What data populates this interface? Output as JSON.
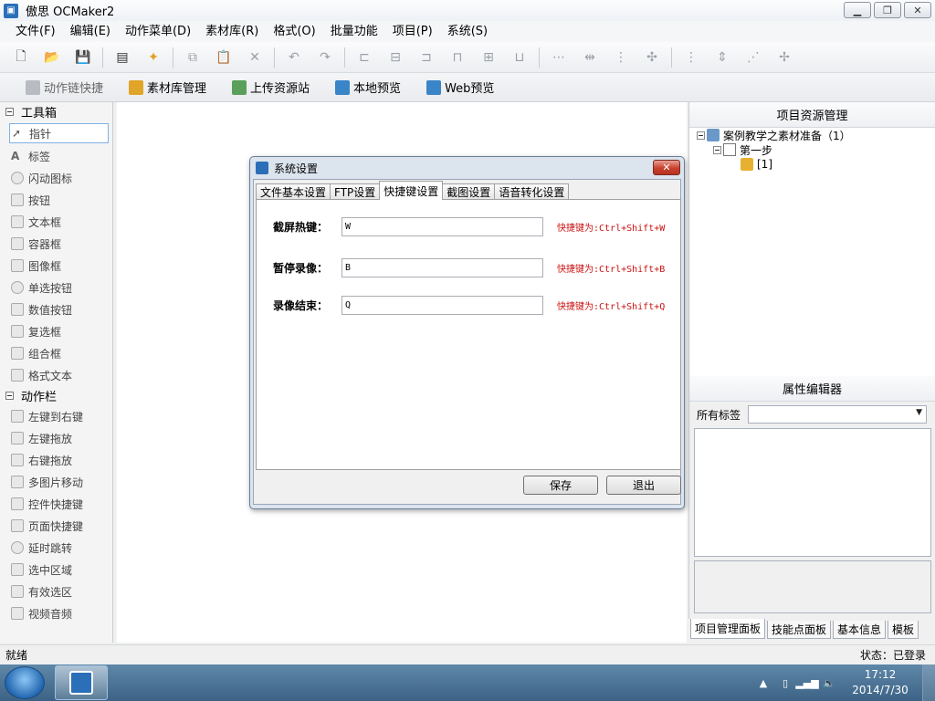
{
  "window": {
    "title": "傲思 OCMaker2"
  },
  "menubar": {
    "items": [
      "文件(F)",
      "编辑(E)",
      "动作菜单(D)",
      "素材库(R)",
      "格式(O)",
      "批量功能",
      "项目(P)",
      "系统(S)"
    ]
  },
  "shortcutbar": {
    "action_link": "动作链快捷",
    "library": "素材库管理",
    "upload": "上传资源站",
    "local_preview": "本地预览",
    "web_preview": "Web预览"
  },
  "toolbox": {
    "section1": "工具箱",
    "tools": [
      "指针",
      "标签",
      "闪动图标",
      "按钮",
      "文本框",
      "容器框",
      "图像框",
      "单选按钮",
      "数值按钮",
      "复选框",
      "组合框",
      "格式文本"
    ],
    "section2": "动作栏",
    "actions": [
      "左键到右键",
      "左键拖放",
      "右键拖放",
      "多图片移动",
      "控件快捷键",
      "页面快捷键",
      "延时跳转",
      "选中区域",
      "有效选区",
      "视频音频"
    ]
  },
  "project_panel": {
    "title": "项目资源管理",
    "root": "案例教学之素材准备（1）",
    "step": "第一步",
    "leaf": "[1]"
  },
  "property_panel": {
    "title": "属性编辑器",
    "all_tags_label": "所有标签"
  },
  "right_tabs": [
    "项目管理面板",
    "技能点面板",
    "基本信息",
    "模板"
  ],
  "statusbar": {
    "left": "就绪",
    "right": "状态：已登录"
  },
  "dialog": {
    "title": "系统设置",
    "tabs": [
      "文件基本设置",
      "FTP设置",
      "快捷键设置",
      "截图设置",
      "语音转化设置"
    ],
    "fields": [
      {
        "label": "截屏热键：",
        "value": "W",
        "hint": "快捷键为:Ctrl+Shift+W"
      },
      {
        "label": "暂停录像：",
        "value": "B",
        "hint": "快捷键为:Ctrl+Shift+B"
      },
      {
        "label": "录像结束：",
        "value": "Q",
        "hint": "快捷键为:Ctrl+Shift+Q"
      }
    ],
    "save": "保存",
    "exit": "退出"
  },
  "taskbar": {
    "time": "17:12",
    "date": "2014/7/30"
  }
}
